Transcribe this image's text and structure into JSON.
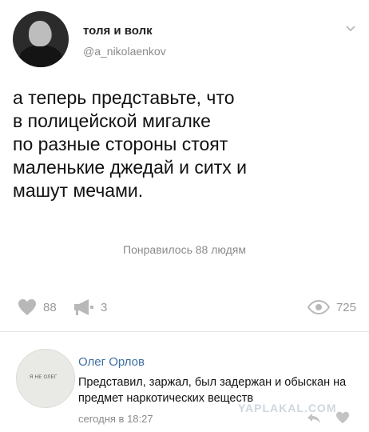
{
  "post": {
    "author_name": "толя и волк",
    "author_handle": "@a_nikolaenkov",
    "text": "а теперь представьте, что\nв полицейской мигалке\nпо разные стороны стоят\nмаленькие джедай и ситх и\nмашут мечами.",
    "likes_summary": "Понравилось 88 людям"
  },
  "stats": {
    "likes": "88",
    "reposts": "3",
    "views": "725"
  },
  "comment": {
    "avatar_text": "Я НЕ ОЛЕГ",
    "author": "Олег Орлов",
    "text": "Представил, заржал, был задержан и обыскан на предмет наркотических веществ",
    "time": "сегодня в 18:27"
  },
  "watermark": "YAPLAKAL.COM",
  "icons": {
    "chevron": "chevron-down-icon",
    "like": "heart-icon",
    "repost": "megaphone-icon",
    "views": "eye-icon",
    "reply": "reply-icon"
  }
}
